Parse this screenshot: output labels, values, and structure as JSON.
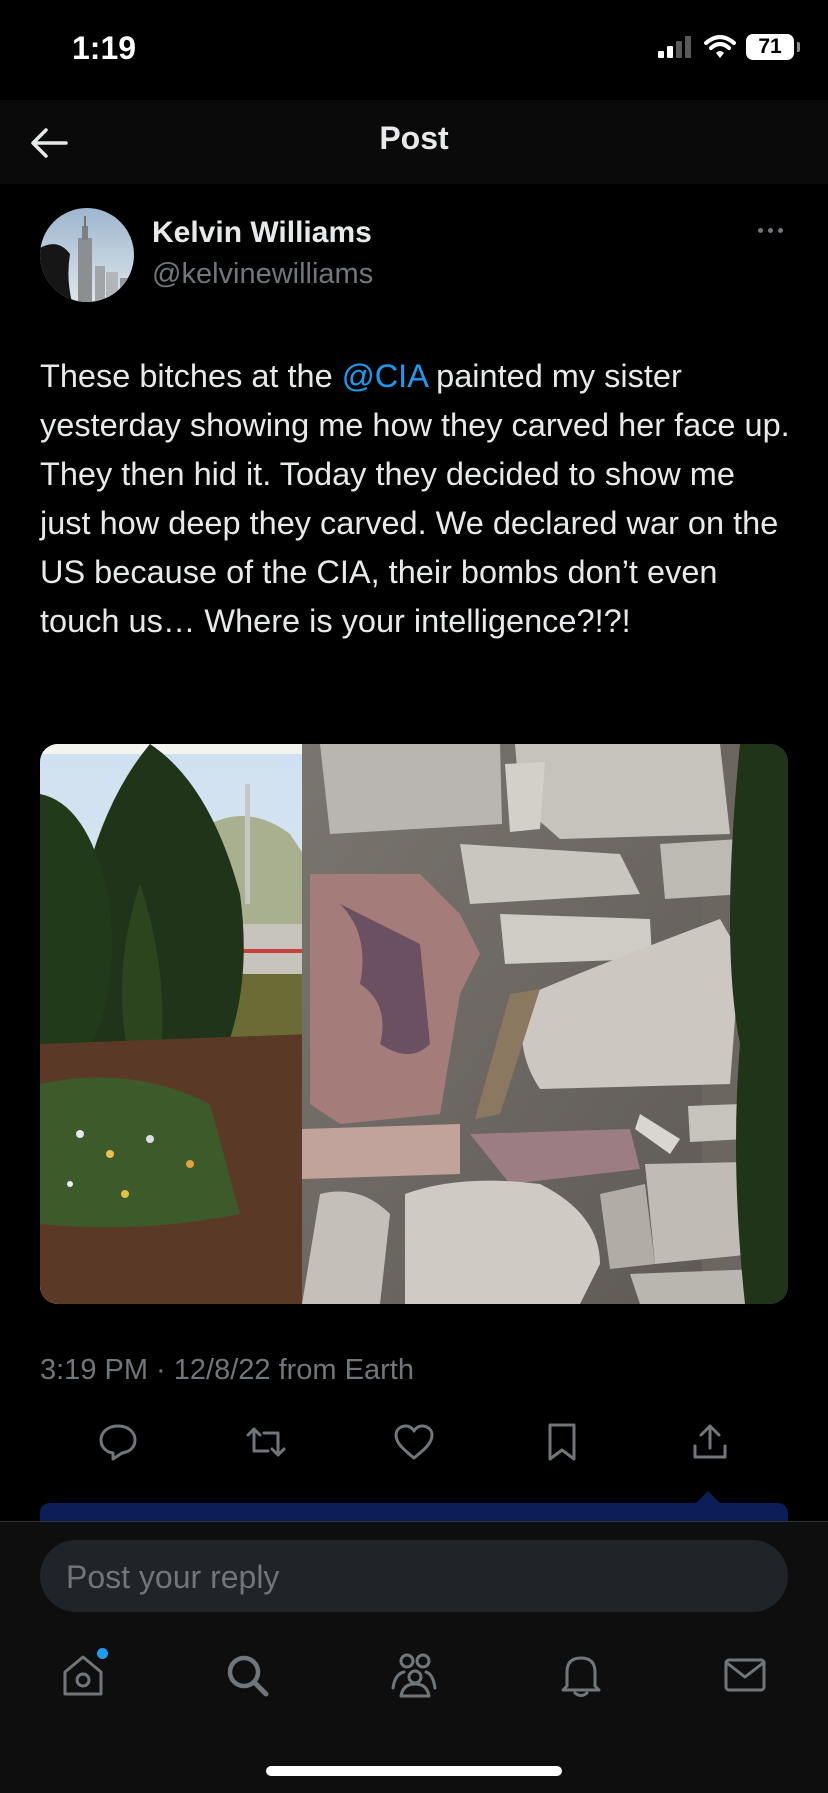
{
  "status_bar": {
    "time": "1:19",
    "battery": "71"
  },
  "header": {
    "title": "Post"
  },
  "post": {
    "author_name": "Kelvin Williams",
    "author_handle": "@kelvinewilliams",
    "text_before": "These bitches at the ",
    "mention": "@CIA",
    "text_after": " painted my sister yesterday showing me how they carved her face up. They then hid it. Today they decided to show me just how deep they carved. We declared war on the US because of the CIA, their bombs don’t even touch us… Where is your intelligence?!?!",
    "timestamp": "3:19 PM · 12/8/22 from Earth"
  },
  "actions": [
    "reply-icon",
    "repost-icon",
    "like-icon",
    "bookmark-icon",
    "share-icon"
  ],
  "reply": {
    "placeholder": "Post your reply"
  },
  "tabs": [
    "home-icon",
    "search-icon",
    "communities-icon",
    "notifications-icon",
    "messages-icon"
  ],
  "colors": {
    "accent": "#1d9bf0",
    "background": "#000000",
    "muted": "#71767b"
  }
}
